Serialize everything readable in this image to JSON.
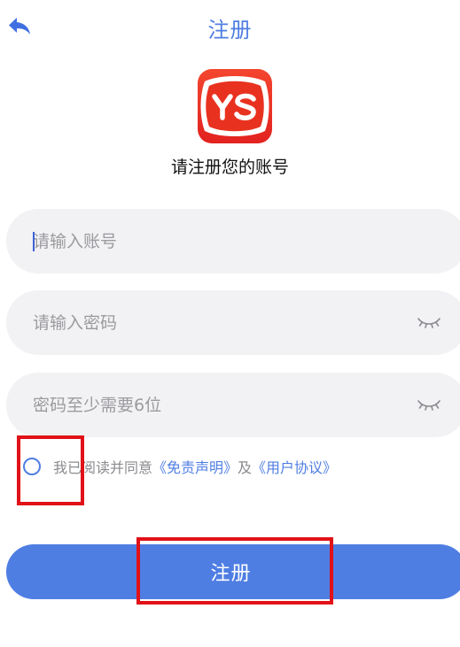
{
  "header": {
    "title": "注册",
    "back_icon": "back-arrow-icon"
  },
  "brand": {
    "logo_text": "YS",
    "logo_color": "#e8321f",
    "subtitle": "请注册您的账号"
  },
  "form": {
    "account": {
      "placeholder": "请输入账号",
      "value": ""
    },
    "password": {
      "placeholder": "请输入密码",
      "value": "",
      "toggle_icon": "eye-closed-icon"
    },
    "confirm": {
      "placeholder": "密码至少需要6位",
      "value": "",
      "toggle_icon": "eye-closed-icon"
    }
  },
  "agreement": {
    "checked": false,
    "prefix": "我已阅读并同意",
    "disclaimer_link": "《免责声明》",
    "conjunction": "及",
    "terms_link": "《用户协议》"
  },
  "submit": {
    "label": "注册"
  },
  "colors": {
    "accent": "#4f7ee3",
    "field_bg": "#f2f2f4",
    "highlight": "#e01218"
  }
}
